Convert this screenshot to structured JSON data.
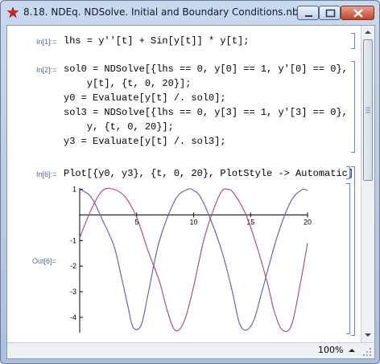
{
  "window": {
    "title": "8.18. NDEq. NDSolve. Initial and Boundary Conditions.nb"
  },
  "notebook": {
    "in1_label": "In[1]:=",
    "in1_line": "lhs = y''[t] + Sin[y[t]] * y[t];",
    "in2_label": "In[2]:=",
    "in2_lines": [
      "sol0 = NDSolve[{lhs == 0, y[0] == 1, y'[0] == 0},",
      "    y[t], {t, 0, 20}];",
      "y0 = Evaluate[y[t] /. sol0];",
      "sol3 = NDSolve[{lhs == 0, y[3] == 1, y'[3] == 0},",
      "    y, {t, 0, 20}];",
      "y3 = Evaluate[y[t] /. sol3];"
    ],
    "in6_label": "In[6]:=",
    "in6_line": "Plot[{y0, y3}, {t, 0, 20}, PlotStyle -> Automatic]",
    "out6_label": "Out[6]="
  },
  "chart_data": {
    "type": "line",
    "title": "",
    "xlabel": "",
    "ylabel": "",
    "xlim": [
      0,
      20
    ],
    "ylim": [
      -4.6,
      1.05
    ],
    "x_ticks": [
      5,
      10,
      15,
      20
    ],
    "y_ticks": [
      1,
      -1,
      -2,
      -3,
      -4
    ],
    "series": [
      {
        "color": "#5b5bab",
        "x": [
          0,
          1,
          2,
          3,
          3.6,
          4.2,
          4.7,
          5.4,
          6.0,
          7.0,
          8.4,
          9.5,
          10.0,
          10.6,
          11.6,
          12.6,
          13.4,
          14.0,
          14.6,
          15.3,
          16.0,
          17.3,
          18.5,
          19.5,
          20
        ],
        "y": [
          1,
          0.7,
          -0.2,
          -1.2,
          -2.3,
          -3.5,
          -4.4,
          -4.3,
          -3.1,
          -1.0,
          0.6,
          1.0,
          0.95,
          0.7,
          -0.3,
          -1.6,
          -3.0,
          -4.2,
          -4.5,
          -4.1,
          -3.0,
          -0.9,
          0.5,
          0.98,
          0.95
        ]
      },
      {
        "color": "#a8447a",
        "x": [
          0,
          1,
          2,
          3,
          4,
          5,
          6,
          7,
          7.6,
          8.2,
          8.7,
          9.3,
          10.0,
          11.0,
          12.3,
          13.0,
          13.6,
          14.6,
          15.6,
          16.5,
          17.1,
          17.8,
          18.6,
          19.4,
          20
        ],
        "y": [
          -0.9,
          0.2,
          0.95,
          1.0,
          0.7,
          -0.1,
          -1.4,
          -2.6,
          -3.6,
          -4.4,
          -4.5,
          -4.0,
          -2.8,
          -0.8,
          0.8,
          1.0,
          0.8,
          0.0,
          -1.3,
          -2.7,
          -3.8,
          -4.5,
          -4.3,
          -2.6,
          -1.1
        ]
      }
    ]
  },
  "statusbar": {
    "zoom": "100%"
  }
}
